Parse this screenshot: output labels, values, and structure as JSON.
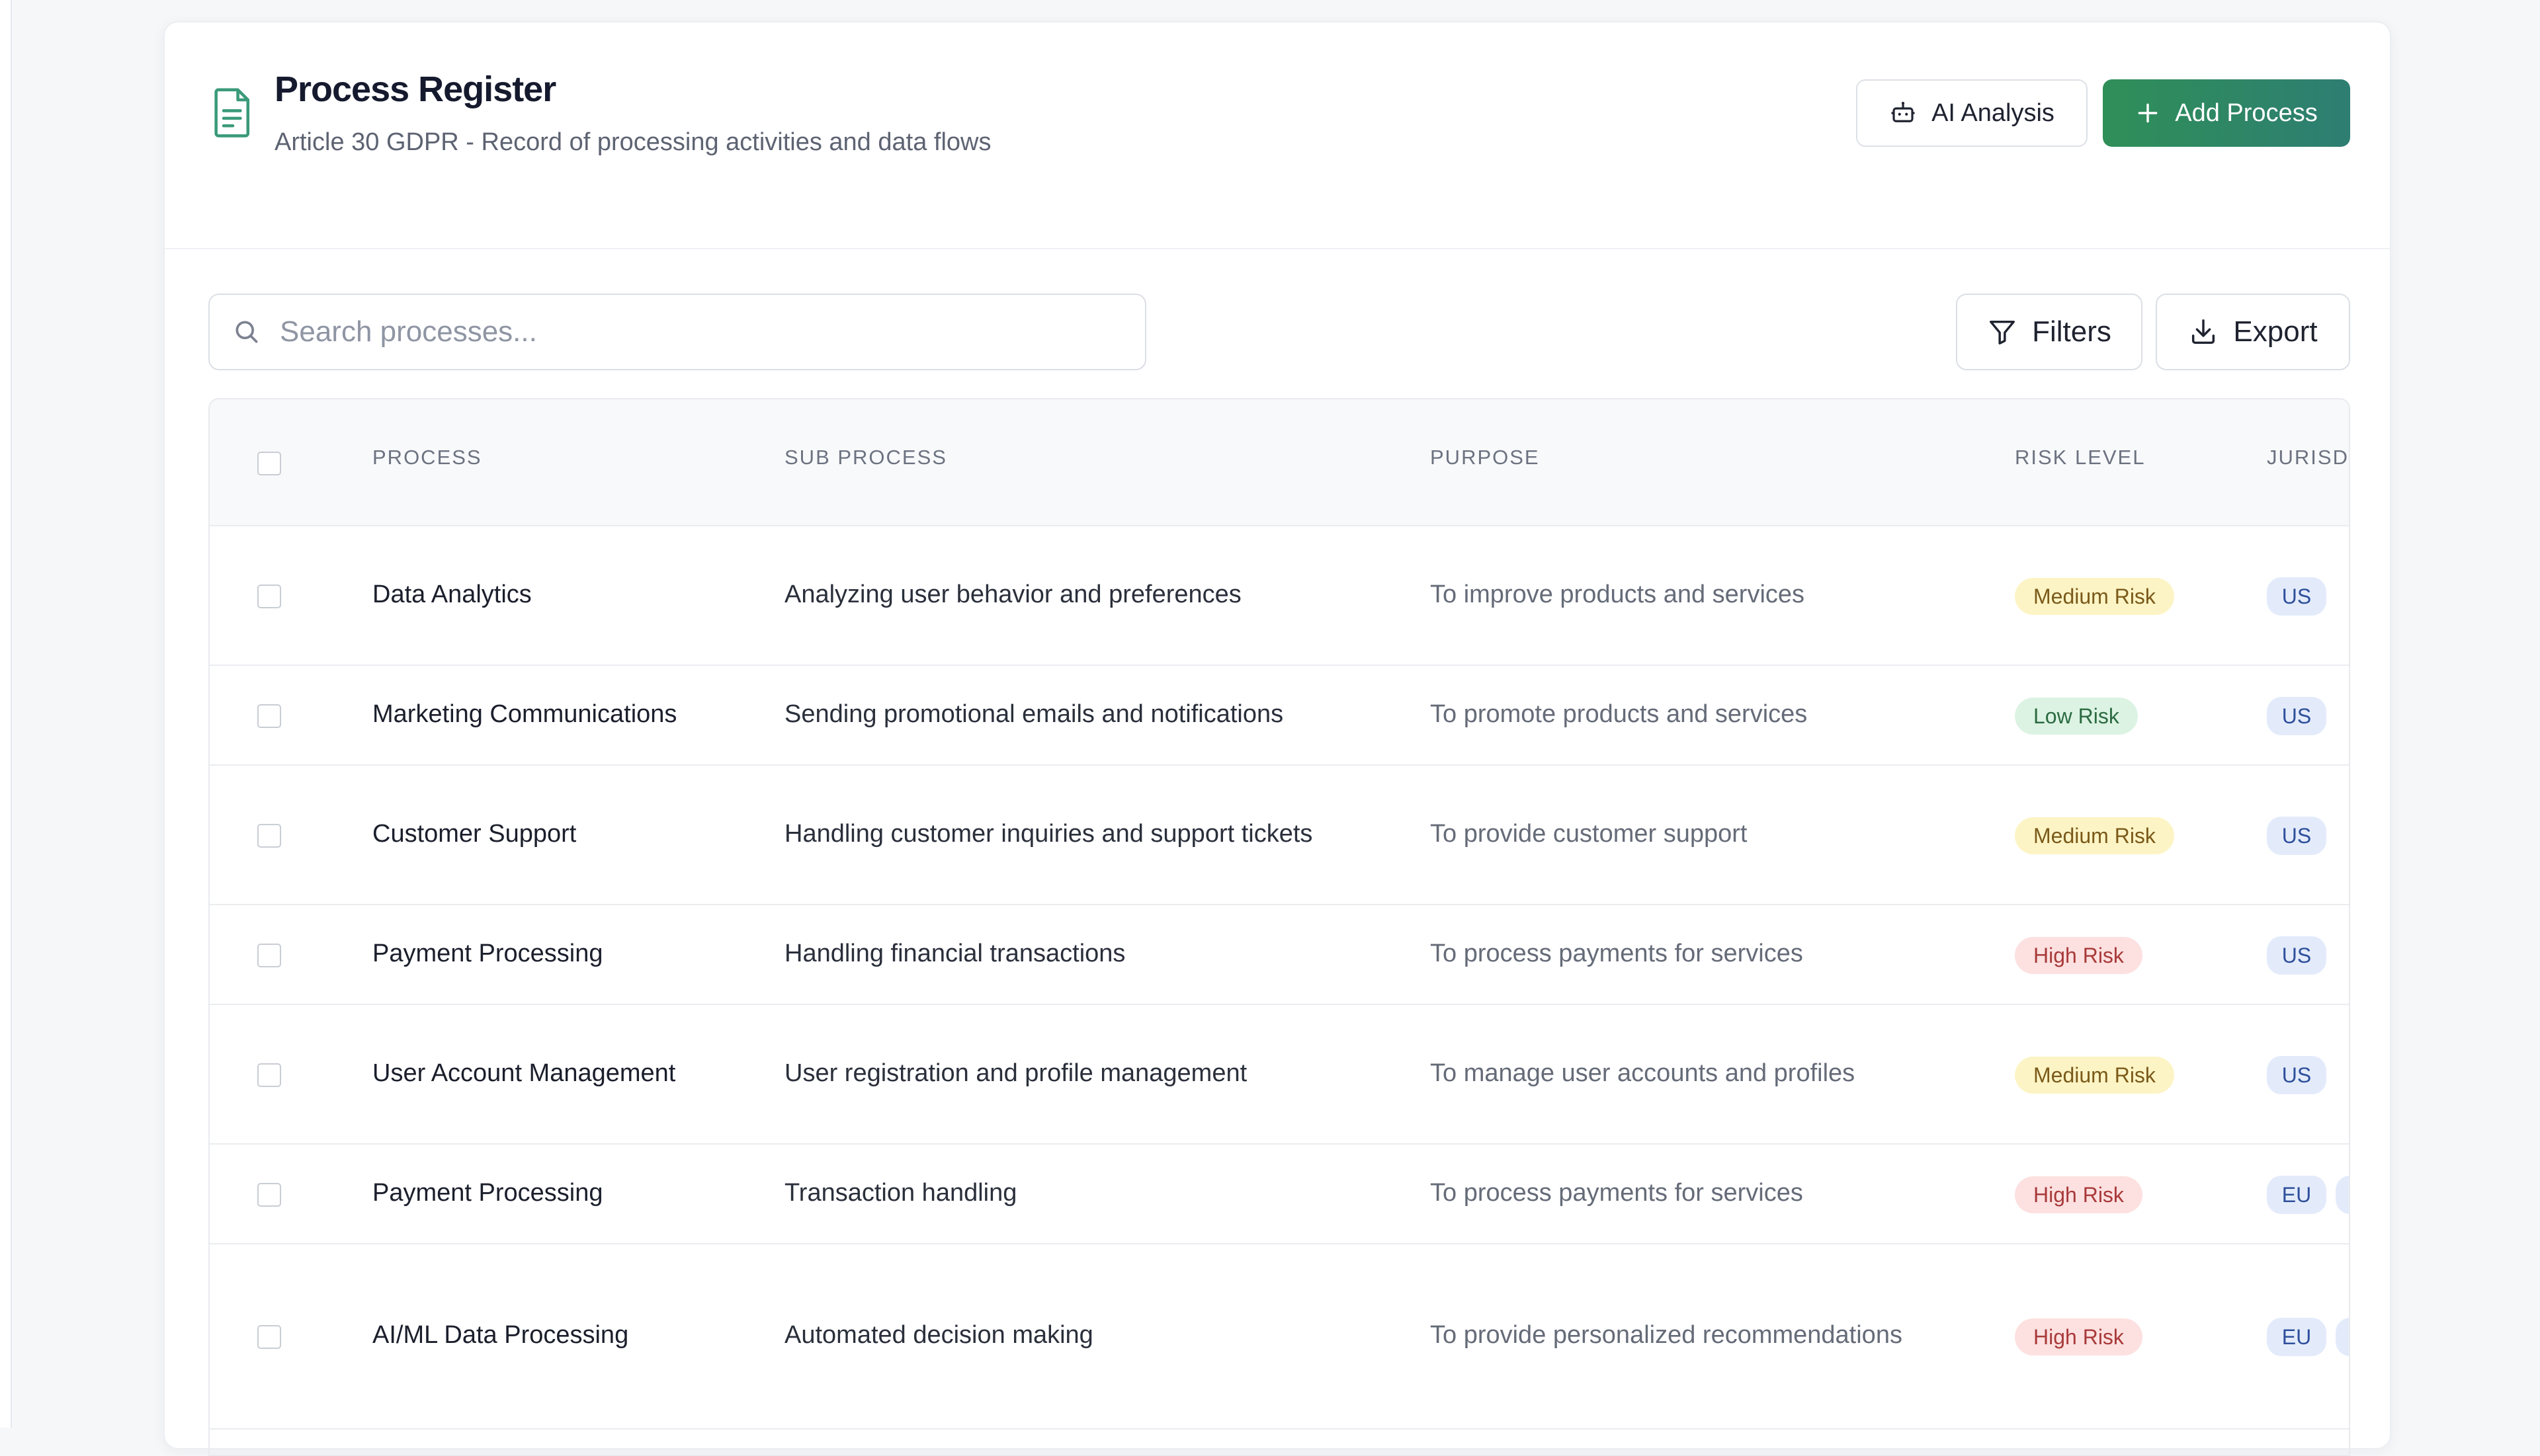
{
  "header": {
    "title": "Process Register",
    "subtitle": "Article 30 GDPR - Record of processing activities and data flows",
    "ai_button_label": "AI Analysis",
    "add_button_label": "Add Process",
    "ai_icon": "robot-icon",
    "add_icon": "plus-icon",
    "doc_icon": "document-icon",
    "accent_color": "#2f8f58"
  },
  "toolbar": {
    "search_placeholder": "Search processes...",
    "search_value": "",
    "filters_label": "Filters",
    "export_label": "Export"
  },
  "table": {
    "columns": [
      "PROCESS",
      "SUB PROCESS",
      "PURPOSE",
      "RISK LEVEL",
      "JURISD"
    ],
    "rows": [
      {
        "process": "Data Analytics",
        "sub_process": "Analyzing user behavior and preferences",
        "purpose": "To improve products and services",
        "risk": "Medium Risk",
        "risk_level": "medium",
        "jurisdiction": "US",
        "extra_jurisdiction": false
      },
      {
        "process": "Marketing Communications",
        "sub_process": "Sending promotional emails and notifications",
        "purpose": "To promote products and services",
        "risk": "Low Risk",
        "risk_level": "low",
        "jurisdiction": "US",
        "extra_jurisdiction": false
      },
      {
        "process": "Customer Support",
        "sub_process": "Handling customer inquiries and support tickets",
        "purpose": "To provide customer support",
        "risk": "Medium Risk",
        "risk_level": "medium",
        "jurisdiction": "US",
        "extra_jurisdiction": false
      },
      {
        "process": "Payment Processing",
        "sub_process": "Handling financial transactions",
        "purpose": "To process payments for services",
        "risk": "High Risk",
        "risk_level": "high",
        "jurisdiction": "US",
        "extra_jurisdiction": false
      },
      {
        "process": "User Account Management",
        "sub_process": "User registration and profile management",
        "purpose": "To manage user accounts and profiles",
        "risk": "Medium Risk",
        "risk_level": "medium",
        "jurisdiction": "US",
        "extra_jurisdiction": false
      },
      {
        "process": "Payment Processing",
        "sub_process": "Transaction handling",
        "purpose": "To process payments for services",
        "risk": "High Risk",
        "risk_level": "high",
        "jurisdiction": "EU",
        "extra_jurisdiction": true
      },
      {
        "process": "AI/ML Data Processing",
        "sub_process": "Automated decision making",
        "purpose": "To provide personalized recommendations",
        "risk": "High Risk",
        "risk_level": "high",
        "jurisdiction": "EU",
        "extra_jurisdiction": true
      }
    ]
  },
  "colors": {
    "medium_risk_bg": "#fdf4c5",
    "low_risk_bg": "#dcf3e3",
    "high_risk_bg": "#fde0e0",
    "jurisdiction_bg": "#e3ebfb"
  }
}
